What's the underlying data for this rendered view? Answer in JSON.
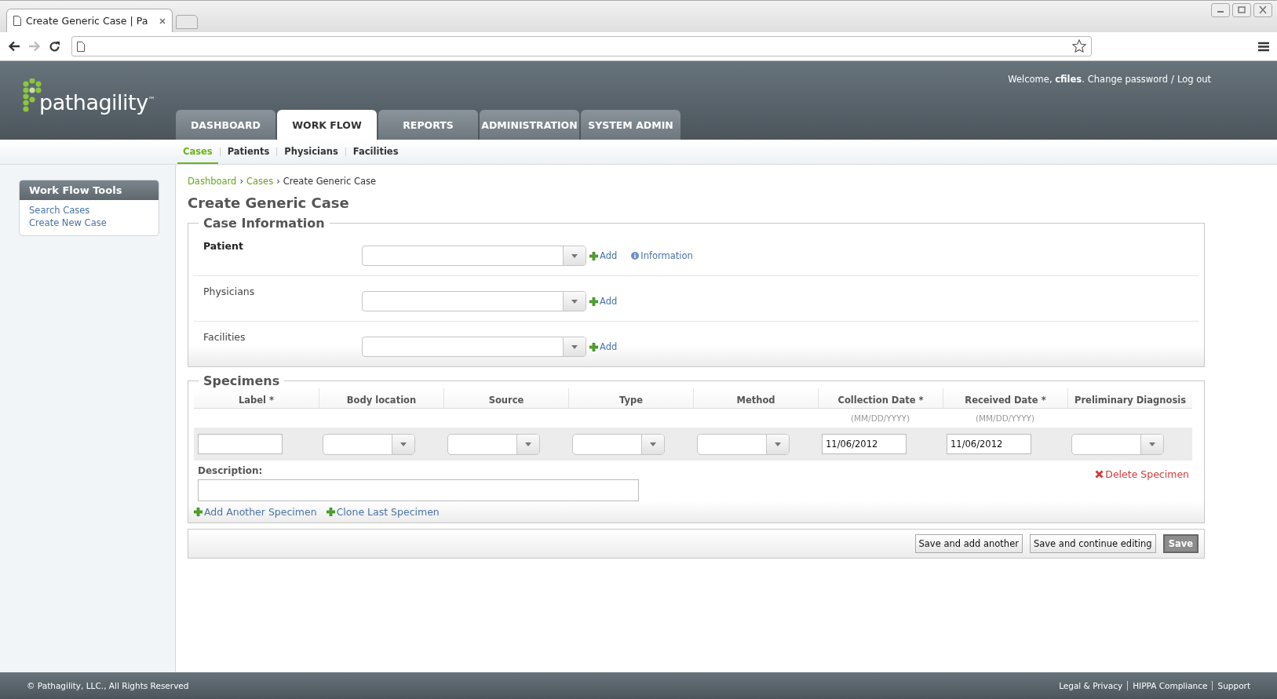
{
  "browser": {
    "tab_title": "Create Generic Case | Pa"
  },
  "header": {
    "logo": "pathagility",
    "trademark": "™",
    "welcome": "Welcome, **cfiles**.",
    "change_password": "Change password",
    "separator": "/",
    "logout": "Log out"
  },
  "main_tabs": [
    {
      "label": "DASHBOARD",
      "selected": false
    },
    {
      "label": "WORK FLOW",
      "selected": true
    },
    {
      "label": "REPORTS",
      "selected": false
    },
    {
      "label": "ADMINISTRATION",
      "selected": false
    },
    {
      "label": "SYSTEM ADMIN",
      "selected": false
    }
  ],
  "sub_nav": [
    {
      "label": "Cases",
      "selected": true
    },
    {
      "label": "Patients",
      "selected": false
    },
    {
      "label": "Physicians",
      "selected": false
    },
    {
      "label": "Facilities",
      "selected": false
    }
  ],
  "sidebar": {
    "title": "Work Flow Tools",
    "links": [
      "Search Cases",
      "Create New Case"
    ]
  },
  "breadcrumb": {
    "links": [
      "Dashboard",
      "Cases"
    ],
    "separator": "›",
    "current": "Create Generic Case"
  },
  "page_title": "Create Generic Case",
  "case_information": {
    "legend": "Case Information",
    "rows": [
      {
        "label": "Patient",
        "required": true,
        "add": "Add",
        "info": "Information"
      },
      {
        "label": "Physicians",
        "required": false,
        "add": "Add"
      },
      {
        "label": "Facilities",
        "required": false,
        "add": "Add"
      }
    ]
  },
  "specimens": {
    "legend": "Specimens",
    "columns": [
      {
        "label": "Label *"
      },
      {
        "label": "Body location"
      },
      {
        "label": "Source"
      },
      {
        "label": "Type"
      },
      {
        "label": "Method"
      },
      {
        "label": "Collection Date *",
        "hint": "(MM/DD/YYYY)"
      },
      {
        "label": "Received Date *",
        "hint": "(MM/DD/YYYY)"
      },
      {
        "label": "Preliminary Diagnosis"
      }
    ],
    "cells": [
      {
        "kind": "text"
      },
      {
        "kind": "select"
      },
      {
        "kind": "select"
      },
      {
        "kind": "select"
      },
      {
        "kind": "select"
      },
      {
        "kind": "text",
        "value": "11/06/2012"
      },
      {
        "kind": "text",
        "value": "11/06/2012"
      },
      {
        "kind": "select"
      }
    ],
    "description_label": "Description:",
    "delete": "Delete Specimen",
    "add_another": "Add Another Specimen",
    "clone_last": "Clone Last Specimen"
  },
  "buttons": [
    {
      "label": "Save and add another",
      "kind": "secondary"
    },
    {
      "label": "Save and continue editing",
      "kind": "secondary"
    },
    {
      "label": "Save",
      "kind": "primary"
    }
  ],
  "footer": {
    "copyright": "© Pathagility, LLC., All Rights Reserved",
    "links": [
      "Legal & Privacy",
      "HIPPA Compliance",
      "Support"
    ]
  }
}
